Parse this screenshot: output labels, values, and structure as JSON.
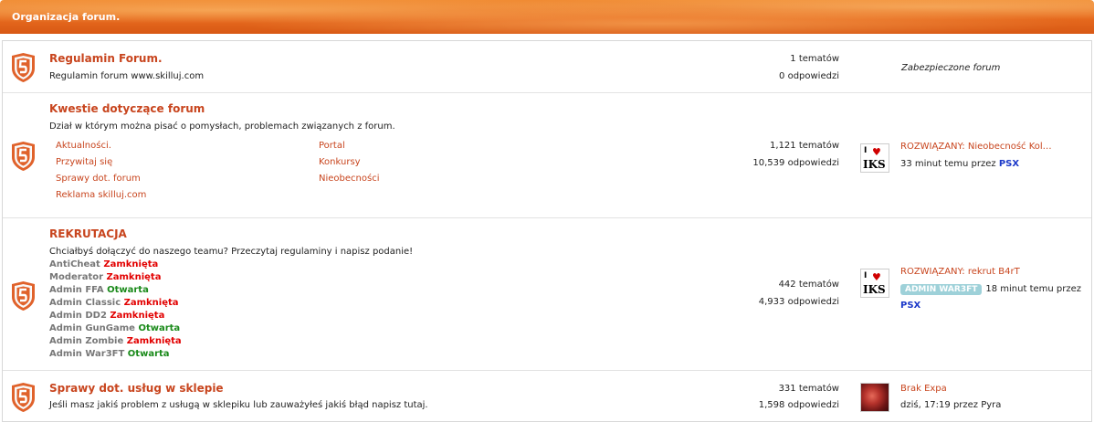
{
  "header": {
    "title": "Organizacja forum."
  },
  "forums": [
    {
      "title": "Regulamin Forum.",
      "description": "Regulamin forum www.skilluj.com",
      "topics": "1 tematów",
      "replies": "0 odpowiedzi",
      "last_post_note": "Zabezpieczone forum"
    },
    {
      "title": "Kwestie dotyczące forum",
      "description": "Dział w którym można pisać o pomysłach, problemach związanych z forum.",
      "subforums": [
        "Aktualności.",
        "Przywitaj się",
        "Sprawy dot. forum",
        "Reklama skilluj.com",
        "Portal",
        "Konkursy",
        "Nieobecności"
      ],
      "topics": "1,121 tematów",
      "replies": "10,539 odpowiedzi",
      "last_post": {
        "title": "ROZWIĄZANY: Nieobecność Kol…",
        "meta": "33 minut temu przez",
        "user": "PSX"
      }
    },
    {
      "title": "REKRUTACJA",
      "description": "Chciałbyś dołączyć do naszego teamu? Przeczytaj regulaminy i napisz podanie!",
      "recruitment": [
        {
          "name": "AntiCheat",
          "status": "Zamknięta",
          "color": "#e20000"
        },
        {
          "name": "Moderator",
          "status": "Zamknięta",
          "color": "#e20000"
        },
        {
          "name": "Admin FFA",
          "status": "Otwarta",
          "color": "#1a8a1a"
        },
        {
          "name": "Admin Classic",
          "status": "Zamknięta",
          "color": "#e20000"
        },
        {
          "name": "Admin DD2",
          "status": "Zamknięta",
          "color": "#e20000"
        },
        {
          "name": "Admin GunGame",
          "status": "Otwarta",
          "color": "#1a8a1a"
        },
        {
          "name": "Admin Zombie",
          "status": "Zamknięta",
          "color": "#e20000"
        },
        {
          "name": "Admin War3FT",
          "status": "Otwarta",
          "color": "#1a8a1a"
        }
      ],
      "topics": "442 tematów",
      "replies": "4,933 odpowiedzi",
      "last_post": {
        "title": "ROZWIĄZANY: rekrut B4rT",
        "badge": "ADMIN WAR3FT",
        "meta": "18 minut temu przez",
        "user": "PSX"
      }
    },
    {
      "title": "Sprawy dot. usług w sklepie",
      "description": "Jeśli masz jakiś problem z usługą w sklepiku lub zauważyłeś jakiś błąd napisz tutaj.",
      "topics": "331 tematów",
      "replies": "1,598 odpowiedzi",
      "last_post": {
        "title": "Brak Expa",
        "meta": "dziś, 17:19 przez Pyra"
      }
    }
  ],
  "avatar_text": {
    "iks": "IKS",
    "heart": "♥",
    "i": "I"
  },
  "colors": {
    "accent": "#c8451e",
    "header": "#e66a1e",
    "user": "#1c39c9",
    "closed": "#e20000",
    "open": "#1a8a1a"
  }
}
